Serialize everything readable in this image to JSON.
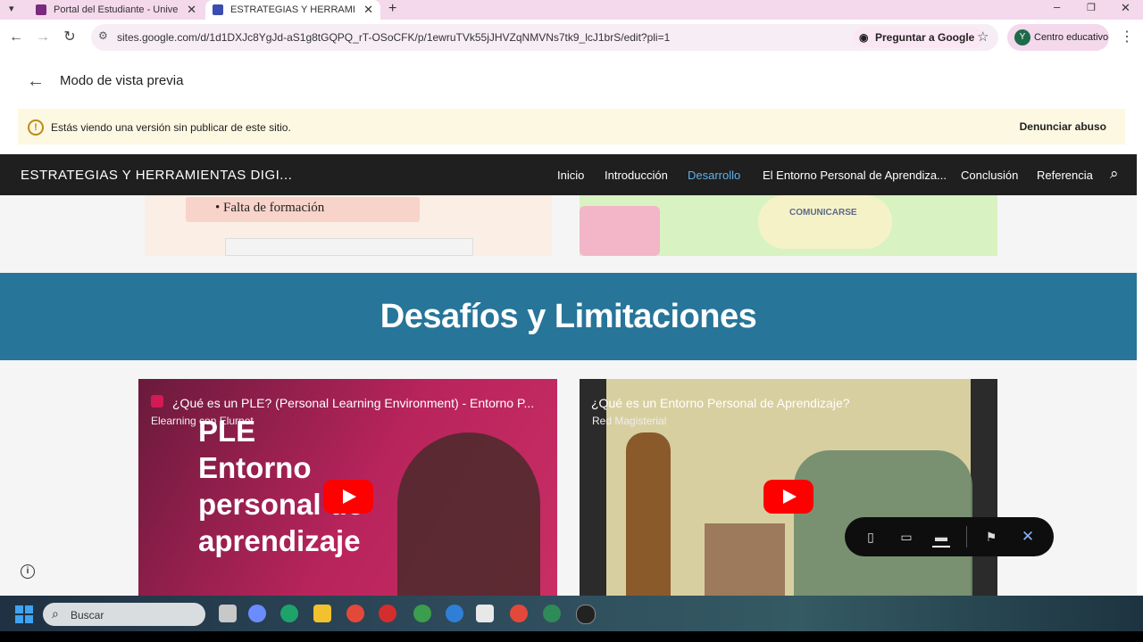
{
  "browser": {
    "tabs": [
      {
        "label": "Portal del Estudiante - Universid",
        "active": false
      },
      {
        "label": "ESTRATEGIAS Y HERRAMIENTAS",
        "active": true
      }
    ],
    "url": "sites.google.com/d/1d1DXJc8YgJd-aS1g8tGQPQ_rT-OSoCFK/p/1ewruTVk55jJHVZqNMVNs7tk9_lcJ1brS/edit?pli=1",
    "ask_google_label": "Preguntar a Google",
    "profile": {
      "initial": "Y",
      "label": "Centro educativo"
    }
  },
  "preview": {
    "title": "Modo de vista previa",
    "notice": "Estás viendo una versión sin publicar de este sitio.",
    "report_label": "Denunciar abuso"
  },
  "site": {
    "title": "ESTRATEGIAS Y HERRAMIENTAS DIGI...",
    "nav": [
      {
        "label": "Inicio",
        "active": false
      },
      {
        "label": "Introducción",
        "active": false
      },
      {
        "label": "Desarrollo",
        "active": true
      },
      {
        "label": "El Entorno Personal de Aprendiza...",
        "active": false
      },
      {
        "label": "Conclusión",
        "active": false
      },
      {
        "label": "Referencia",
        "active": false
      }
    ],
    "image1_text": "• Falta de formación",
    "image2_text": "COMUNICARSE",
    "section_title": "Desafíos y Limitaciones",
    "videos": [
      {
        "title": "¿Qué es un PLE? (Personal Learning Environment) - Entorno P...",
        "channel": "Elearning con Elurnet",
        "overlay": "PLE\nEntorno\npersonal de\naprendizaje"
      },
      {
        "title": "¿Qué es un Entorno Personal de Aprendizaje?",
        "channel": "Red Magisterial"
      }
    ]
  },
  "taskbar": {
    "search_placeholder": "Buscar"
  }
}
